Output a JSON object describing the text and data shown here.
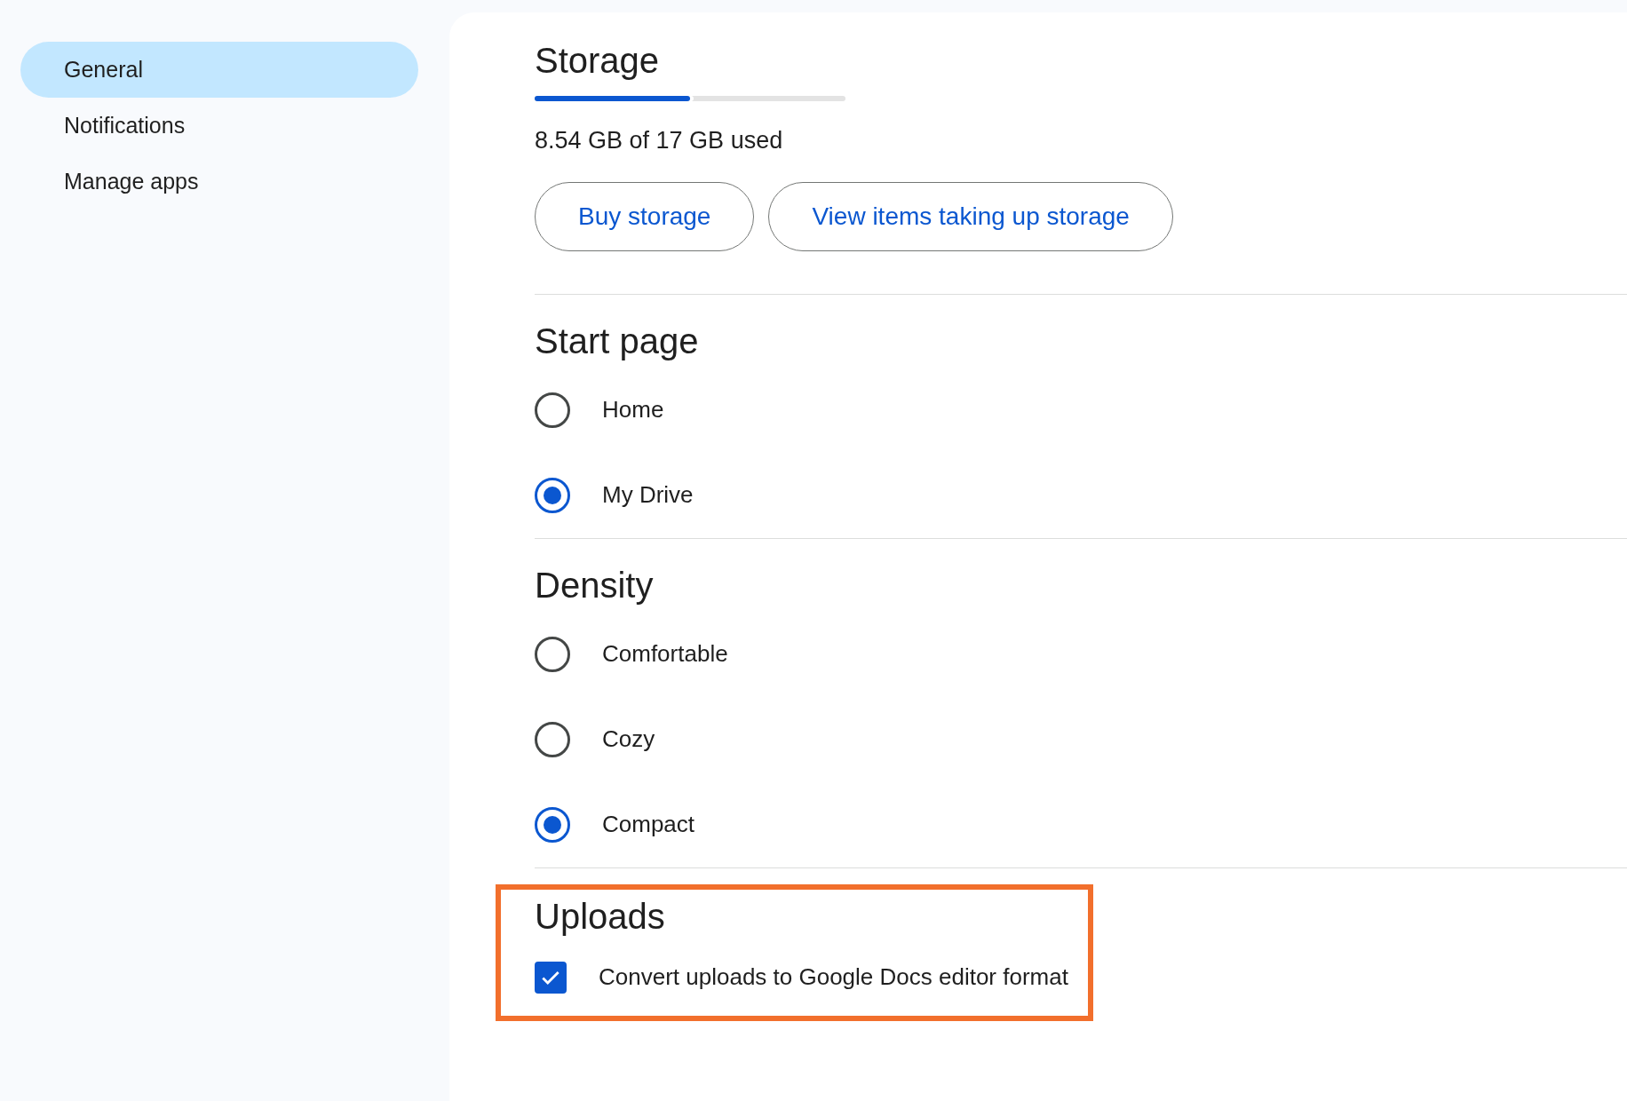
{
  "sidebar": {
    "items": [
      {
        "label": "General",
        "selected": true
      },
      {
        "label": "Notifications",
        "selected": false
      },
      {
        "label": "Manage apps",
        "selected": false
      }
    ]
  },
  "storage": {
    "title": "Storage",
    "level": 0.5,
    "usage": "8.54 GB of 17 GB used",
    "buttons": [
      "Buy storage",
      "View items taking up storage"
    ]
  },
  "start_page": {
    "title": "Start page",
    "options": [
      {
        "label": "Home",
        "selected": false
      },
      {
        "label": "My Drive",
        "selected": true
      }
    ]
  },
  "density": {
    "title": "Density",
    "options": [
      {
        "label": "Comfortable",
        "selected": false
      },
      {
        "label": "Cozy",
        "selected": false
      },
      {
        "label": "Compact",
        "selected": true
      }
    ]
  },
  "uploads": {
    "title": "Uploads",
    "highlighted": true,
    "option": {
      "label": "Convert uploads to Google Docs editor format",
      "checked": true
    }
  }
}
